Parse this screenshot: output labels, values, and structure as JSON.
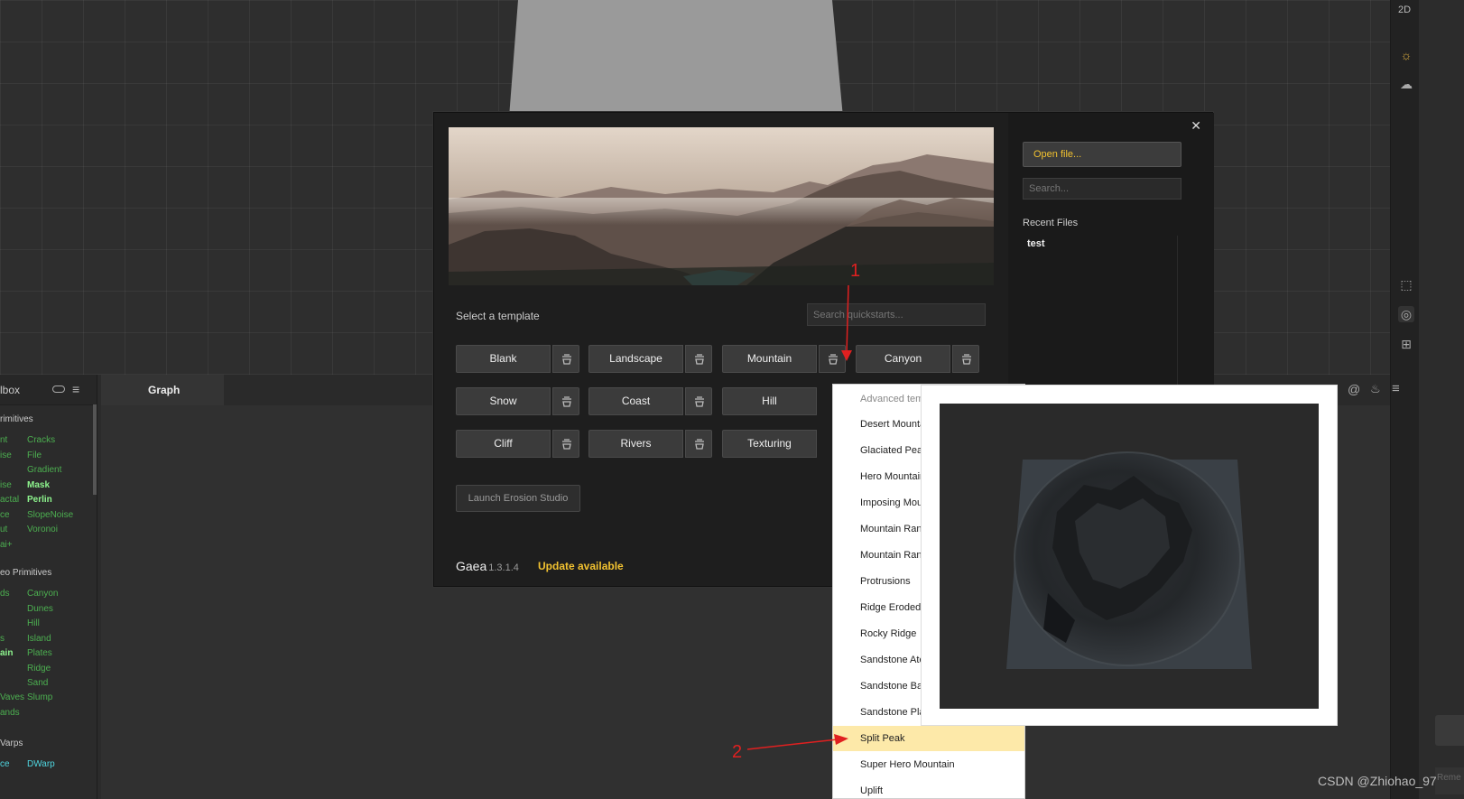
{
  "viewport": {
    "mode_label": "2D"
  },
  "toolbox": {
    "title": "lbox",
    "sections": [
      {
        "label": "rimitives"
      },
      {
        "label": "eo Primitives"
      },
      {
        "label": "Varps"
      }
    ],
    "primitives_left": [
      "nt",
      "ise",
      "",
      "ise",
      "actal",
      "ce",
      "ut",
      "ai+"
    ],
    "primitives_right": [
      "Cracks",
      "File",
      "Gradient",
      "Mask",
      "Perlin",
      "SlopeNoise",
      "Voronoi"
    ],
    "geo_left": [
      "ds",
      "",
      "",
      "s",
      "ain",
      "",
      "",
      "Vaves",
      "ands"
    ],
    "geo_right": [
      "Canyon",
      "Dunes",
      "Hill",
      "Island",
      "Plates",
      "Ridge",
      "Sand",
      "Slump"
    ],
    "warps_left": [
      "ce"
    ],
    "warps_right": [
      "DWarp"
    ]
  },
  "graph": {
    "tab_label": "Graph"
  },
  "dialog": {
    "close": "✕",
    "open_file": "Open file...",
    "search_placeholder": "Search...",
    "recent_label": "Recent Files",
    "recent_items": [
      "test"
    ],
    "select_template": "Select a template",
    "quick_search_placeholder": "Search quickstarts...",
    "templates": [
      "Blank",
      "Landscape",
      "Mountain",
      "Canyon",
      "Snow",
      "Coast",
      "Hill",
      "Cliff",
      "Rivers",
      "Texturing"
    ],
    "launch": "Launch Erosion Studio",
    "brand": "Gaea",
    "version": "1.3.1.4",
    "update": "Update available"
  },
  "dropdown": {
    "header": "Advanced temp",
    "items": [
      "Desert Mounta",
      "Glaciated Peak",
      "Hero Mountain",
      "Imposing Mour",
      "Mountain Rang",
      "Mountain Rang",
      "Protrusions",
      "Ridge Eroded",
      "Rocky Ridge",
      "Sandstone Atol",
      "Sandstone Bas",
      "Sandstone Pla",
      "Split Peak",
      "Super Hero Mountain",
      "Uplift"
    ],
    "selected": "Split Peak"
  },
  "annotations": {
    "one": "1",
    "two": "2"
  },
  "watermark": "CSDN @Zhiohao_97",
  "far_right_label": "Reme",
  "colors": {
    "accent": "#f2c230",
    "arrow": "#e02020",
    "highlight": "#fde9a9",
    "node_green": "#4caf50"
  }
}
